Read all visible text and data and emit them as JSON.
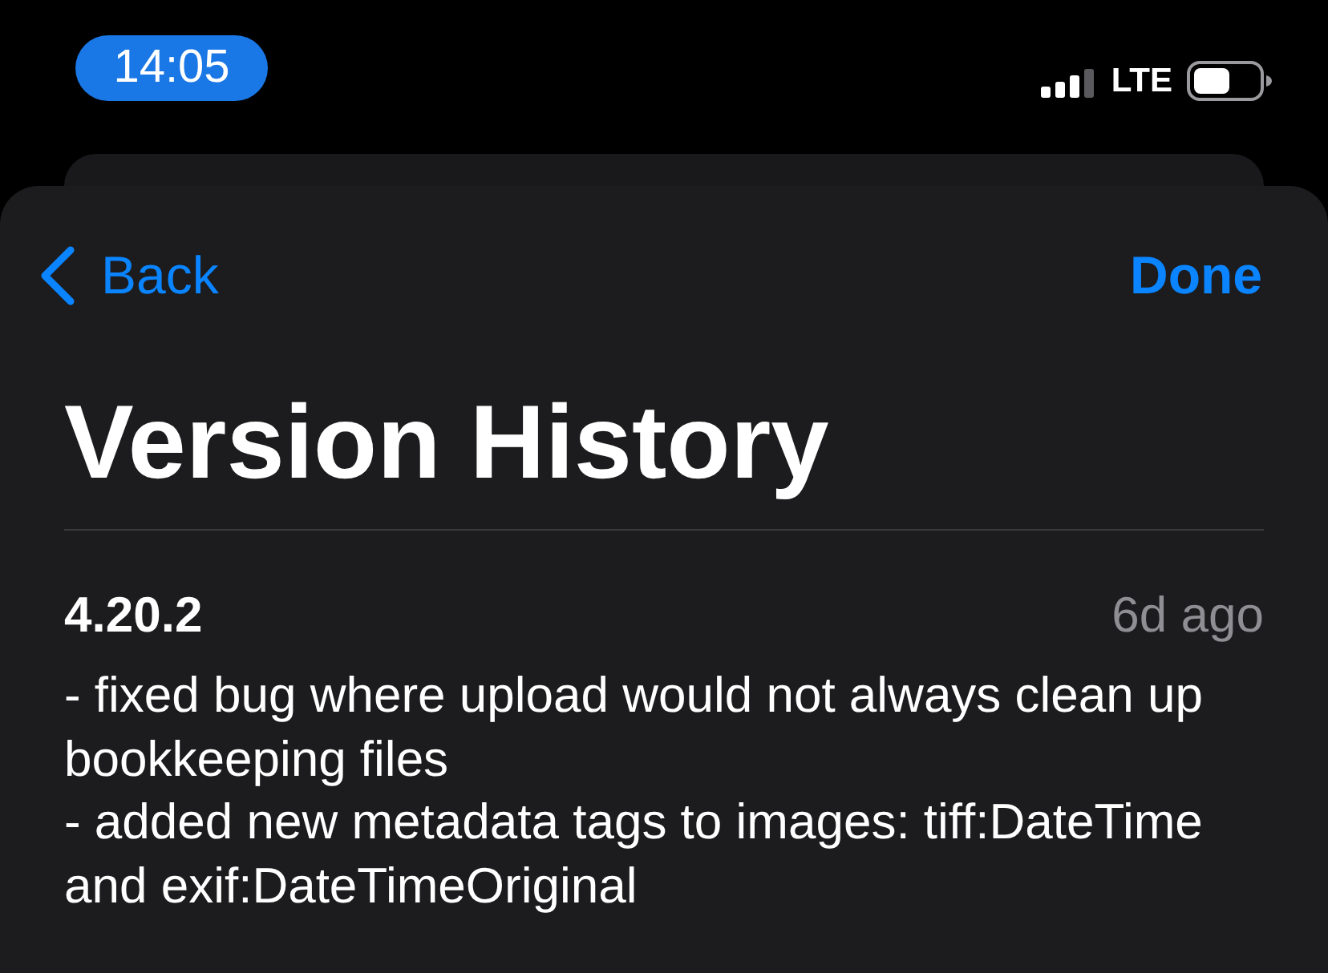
{
  "status_bar": {
    "time": "14:05",
    "network": "LTE"
  },
  "nav": {
    "back": "Back",
    "done": "Done"
  },
  "title": "Version History",
  "releases": [
    {
      "version": "4.20.2",
      "date": "6d ago",
      "notes": [
        "- fixed bug where upload would not always clean up bookkeeping files",
        "- added new metadata tags to images: tiff:DateTime and exif:DateTimeOriginal"
      ]
    }
  ]
}
